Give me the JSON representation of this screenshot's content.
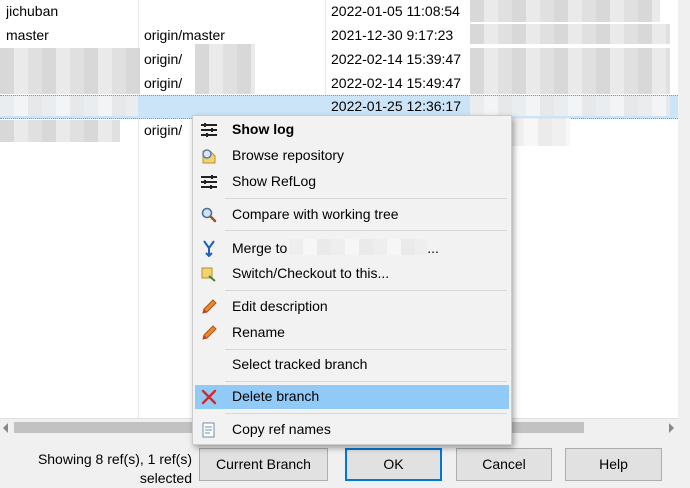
{
  "branches": [
    {
      "name": "jichuban",
      "tracked": "",
      "date": "2022-01-05 11:08:54"
    },
    {
      "name": "master",
      "tracked": "origin/master",
      "date": "2021-12-30 9:17:23"
    },
    {
      "name": "",
      "tracked": "origin/",
      "date": "2022-02-14 15:39:47"
    },
    {
      "name": "",
      "tracked": "origin/",
      "date": "2022-02-14 15:49:47"
    },
    {
      "name": "",
      "tracked": "",
      "date": "2022-01-25 12:36:17"
    },
    {
      "name": "",
      "tracked": "origin/",
      "date": ""
    }
  ],
  "status": {
    "line1": "Showing 8 ref(s), 1 ref(s)",
    "line2": "selected"
  },
  "buttons": {
    "current_branch": "Current Branch",
    "ok": "OK",
    "cancel": "Cancel",
    "help": "Help"
  },
  "menu": {
    "show_log": "Show log",
    "browse_repository": "Browse repository",
    "show_reflog": "Show RefLog",
    "compare": "Compare with working tree",
    "merge_to": "Merge to",
    "merge_suffix": "...",
    "switch_checkout": "Switch/Checkout to this...",
    "edit_description": "Edit description",
    "rename": "Rename",
    "select_tracked": "Select tracked branch",
    "delete_branch": "Delete branch",
    "copy_ref_names": "Copy ref names"
  },
  "colors": {
    "selection": "#cce4f7",
    "menu_highlight": "#91c9f7",
    "default_button_border": "#0078d7"
  }
}
